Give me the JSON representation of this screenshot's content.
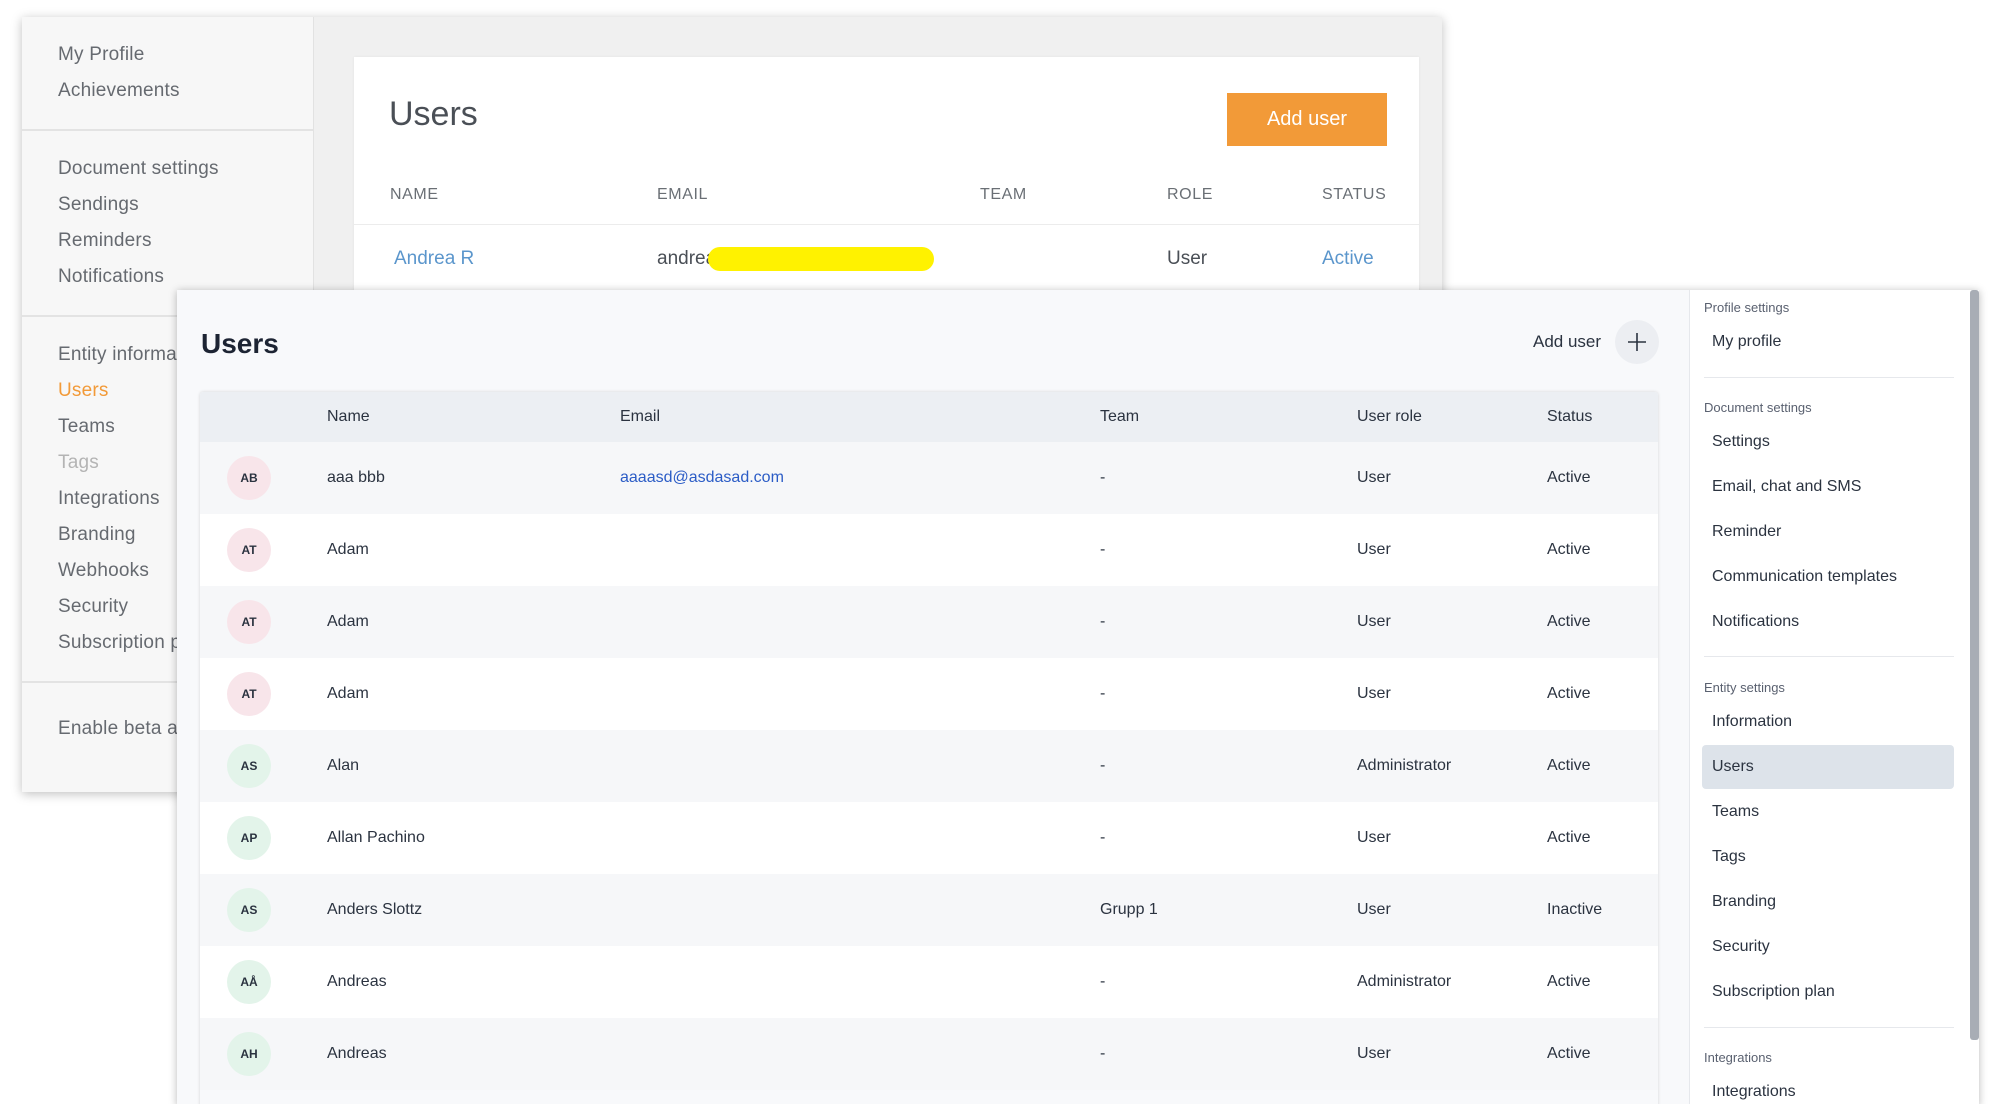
{
  "old_ui": {
    "sidebar": {
      "groups": [
        [
          "My Profile",
          "Achievements"
        ],
        [
          "Document settings",
          "Sendings",
          "Reminders",
          "Notifications"
        ],
        [
          "Entity informa",
          "Users",
          "Teams",
          "Tags",
          "Integrations",
          "Branding",
          "Webhooks",
          "Security",
          "Subscription p"
        ],
        [
          "Enable beta a"
        ]
      ],
      "active_item": "Users",
      "disabled_item": "Tags"
    },
    "title": "Users",
    "add_button": "Add user",
    "columns": [
      "NAME",
      "EMAIL",
      "TEAM",
      "ROLE",
      "STATUS"
    ],
    "row": {
      "name": "Andrea R",
      "email": "andrea.",
      "team": "",
      "role": "User",
      "status": "Active"
    }
  },
  "new_ui": {
    "title": "Users",
    "add_user_label": "Add user",
    "columns": {
      "name": "Name",
      "email": "Email",
      "team": "Team",
      "role": "User role",
      "status": "Status"
    },
    "rows": [
      {
        "initials": "AB",
        "name": "aaa bbb",
        "email": "aaaasd@asdasad.com",
        "team": "-",
        "role": "User",
        "status": "Active"
      },
      {
        "initials": "AT",
        "name": "Adam",
        "email": "",
        "team": "-",
        "role": "User",
        "status": "Active"
      },
      {
        "initials": "AT",
        "name": "Adam",
        "email": "",
        "team": "-",
        "role": "User",
        "status": "Active"
      },
      {
        "initials": "AT",
        "name": "Adam",
        "email": "",
        "team": "-",
        "role": "User",
        "status": "Active"
      },
      {
        "initials": "AS",
        "name": "Alan",
        "email": "",
        "team": "-",
        "role": "Administrator",
        "status": "Active"
      },
      {
        "initials": "AP",
        "name": "Allan Pachino",
        "email": "",
        "team": "-",
        "role": "User",
        "status": "Active"
      },
      {
        "initials": "AS",
        "name": "Anders Slottz",
        "email": "",
        "team": "Grupp 1",
        "role": "User",
        "status": "Inactive"
      },
      {
        "initials": "AÅ",
        "name": "Andreas",
        "email": "",
        "team": "-",
        "role": "Administrator",
        "status": "Active"
      },
      {
        "initials": "AH",
        "name": "Andreas",
        "email": "",
        "team": "-",
        "role": "User",
        "status": "Active"
      }
    ],
    "sidebar": {
      "profile_heading": "Profile settings",
      "profile_items": [
        "My profile"
      ],
      "document_heading": "Document settings",
      "document_items": [
        "Settings",
        "Email, chat and SMS",
        "Reminder",
        "Communication templates",
        "Notifications"
      ],
      "entity_heading": "Entity settings",
      "entity_items": [
        "Information",
        "Users",
        "Teams",
        "Tags",
        "Branding",
        "Security",
        "Subscription plan"
      ],
      "integrations_heading": "Integrations",
      "integrations_items": [
        "Integrations"
      ],
      "active_item": "Users"
    }
  },
  "colors": {
    "old_accent": "#f29a38",
    "old_link": "#5b96cc",
    "new_email_link": "#2b5cc6",
    "new_active_bg": "#dde3ea",
    "avatar_pink": "#f8e5ea",
    "avatar_green": "#e3f4ea",
    "redaction_yellow": "#fff200"
  }
}
